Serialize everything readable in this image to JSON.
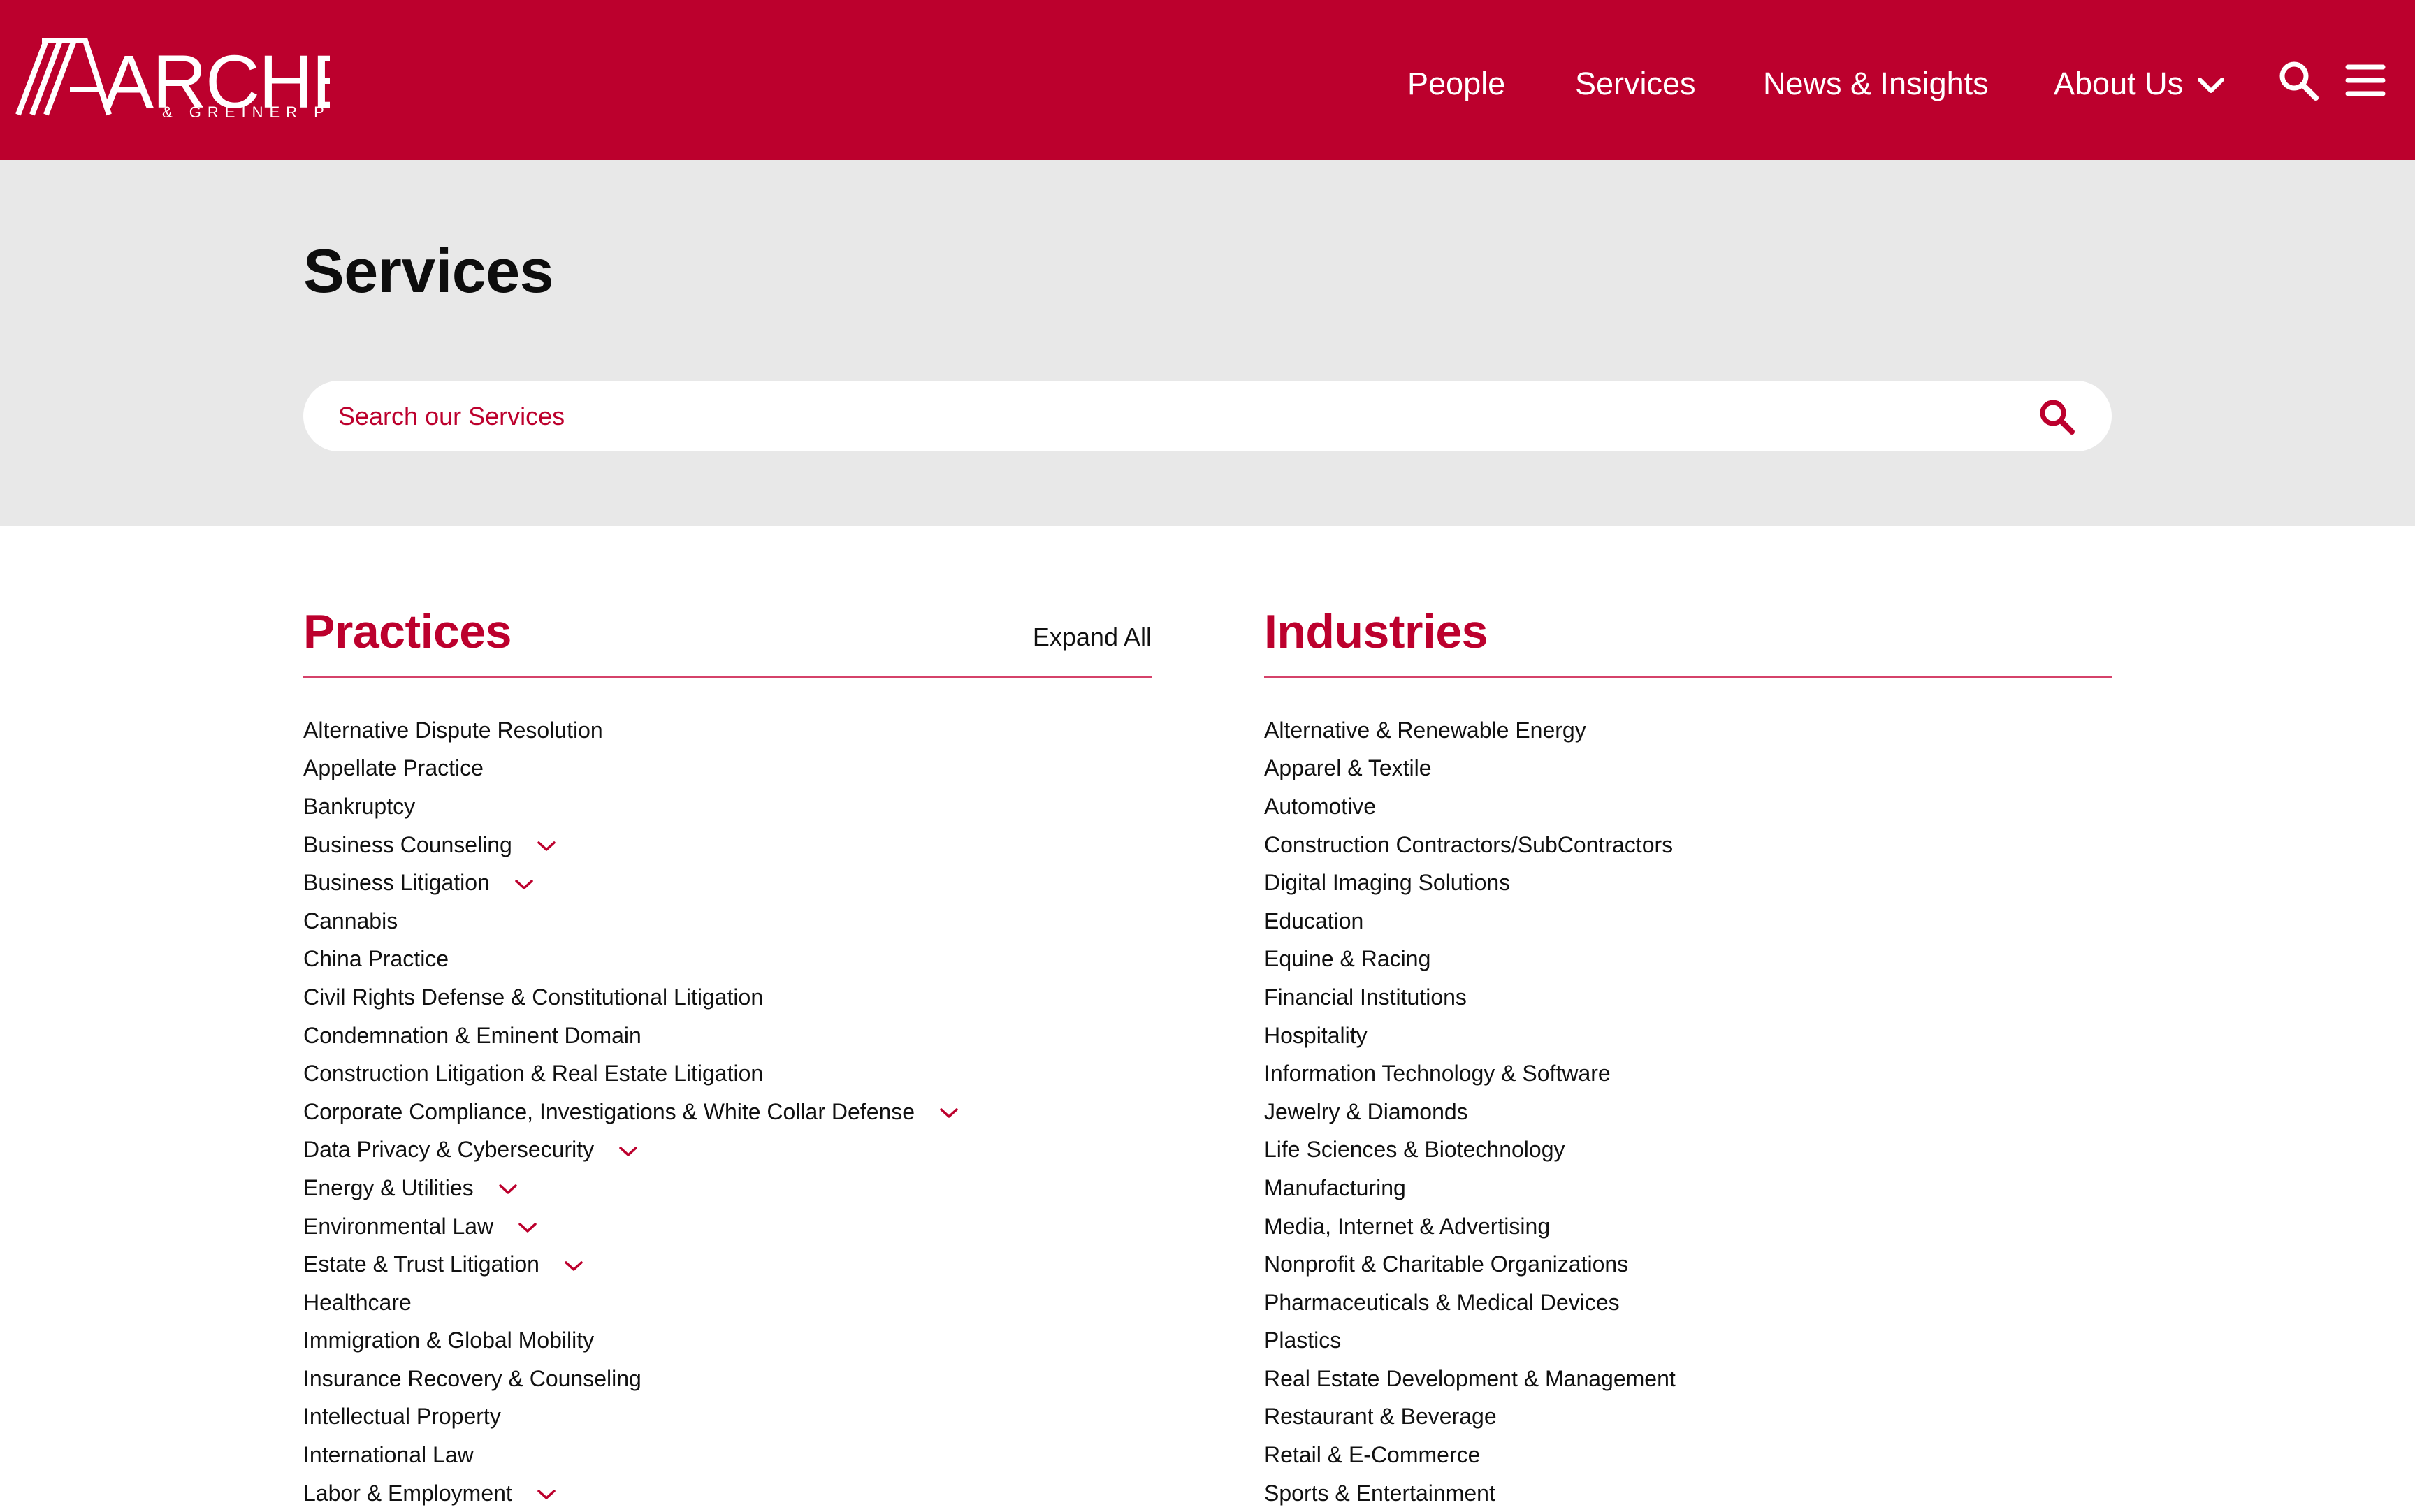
{
  "header": {
    "logo": {
      "main": "ARCHER",
      "sub": "& GREINER P.C."
    },
    "nav": [
      {
        "label": "People"
      },
      {
        "label": "Services"
      },
      {
        "label": "News & Insights"
      },
      {
        "label": "About Us"
      }
    ],
    "icons": [
      "search-icon",
      "hamburger-menu-icon",
      "chevron-down-icon"
    ]
  },
  "hero": {
    "title": "Services",
    "search": {
      "placeholder": "Search our Services",
      "value": ""
    }
  },
  "practices": {
    "heading": "Practices",
    "expand_label": "Expand All",
    "items": [
      {
        "label": "Alternative Dispute Resolution",
        "expandable": false
      },
      {
        "label": "Appellate Practice",
        "expandable": false
      },
      {
        "label": "Bankruptcy",
        "expandable": false
      },
      {
        "label": "Business Counseling",
        "expandable": true
      },
      {
        "label": "Business Litigation",
        "expandable": true
      },
      {
        "label": "Cannabis",
        "expandable": false
      },
      {
        "label": "China Practice",
        "expandable": false
      },
      {
        "label": "Civil Rights Defense & Constitutional Litigation",
        "expandable": false
      },
      {
        "label": "Condemnation & Eminent Domain",
        "expandable": false
      },
      {
        "label": "Construction Litigation & Real Estate Litigation",
        "expandable": false
      },
      {
        "label": "Corporate Compliance, Investigations & White Collar Defense",
        "expandable": true
      },
      {
        "label": "Data Privacy & Cybersecurity",
        "expandable": true
      },
      {
        "label": "Energy & Utilities",
        "expandable": true
      },
      {
        "label": "Environmental Law",
        "expandable": true
      },
      {
        "label": "Estate & Trust Litigation",
        "expandable": true
      },
      {
        "label": "Healthcare",
        "expandable": false
      },
      {
        "label": "Immigration & Global Mobility",
        "expandable": false
      },
      {
        "label": "Insurance Recovery & Counseling",
        "expandable": false
      },
      {
        "label": "Intellectual Property",
        "expandable": false
      },
      {
        "label": "International Law",
        "expandable": false
      },
      {
        "label": "Labor & Employment",
        "expandable": true
      }
    ]
  },
  "industries": {
    "heading": "Industries",
    "items": [
      {
        "label": "Alternative & Renewable Energy"
      },
      {
        "label": "Apparel & Textile"
      },
      {
        "label": "Automotive"
      },
      {
        "label": "Construction Contractors/SubContractors"
      },
      {
        "label": "Digital Imaging Solutions"
      },
      {
        "label": "Education"
      },
      {
        "label": "Equine & Racing"
      },
      {
        "label": "Financial Institutions"
      },
      {
        "label": "Hospitality"
      },
      {
        "label": "Information Technology & Software"
      },
      {
        "label": "Jewelry & Diamonds"
      },
      {
        "label": "Life Sciences & Biotechnology"
      },
      {
        "label": "Manufacturing"
      },
      {
        "label": "Media, Internet & Advertising"
      },
      {
        "label": "Nonprofit & Charitable Organizations"
      },
      {
        "label": "Pharmaceuticals & Medical Devices"
      },
      {
        "label": "Plastics"
      },
      {
        "label": "Real Estate Development & Management"
      },
      {
        "label": "Restaurant & Beverage"
      },
      {
        "label": "Retail & E-Commerce"
      },
      {
        "label": "Sports & Entertainment"
      }
    ]
  },
  "colors": {
    "brand": "#bc002d",
    "hero_bg": "#e8e8e8",
    "text": "#111111",
    "white": "#ffffff"
  }
}
